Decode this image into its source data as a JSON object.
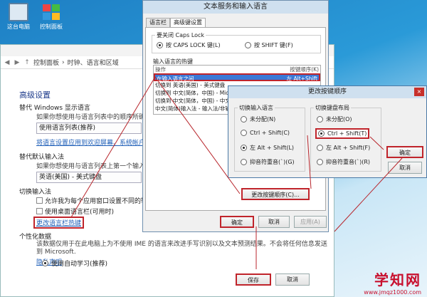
{
  "desktop": {
    "icons": [
      {
        "label": "这台电脑",
        "icon": "computer-icon"
      },
      {
        "label": "控制面板",
        "icon": "control-panel-icon"
      }
    ]
  },
  "control_panel": {
    "window_title": "控制面板\\时钟",
    "breadcrumb": [
      "控制面板",
      "时钟、语言和区域"
    ],
    "advanced_title": "高级设置",
    "display_lang_heading": "替代 Windows 显示语言",
    "display_lang_desc": "如果你想使用与语言列表中的顺序所确定的",
    "display_lang_value": "使用语言列表(推荐)",
    "apply_link": "将语言设置应用到欢迎屏幕、系统帐户和新用户",
    "input_method_heading": "替代默认输入法",
    "input_method_desc": "如果你想使用与语言列表上第一个输入法不同的",
    "input_method_value": "英语(美国) - 美式键盘",
    "switch_heading": "切换输入法",
    "cb_each_window": "允许我为每个应用窗口设置不同的输入法",
    "cb_desktop_bar": "使用桌面语言栏(可用时)",
    "hotkey_link": "更改语言栏热键",
    "personal_heading": "个性化数据",
    "personal_desc": "该数据仅用于在此电脑上为不使用 IME 的语言来改进手写识别以及文本预测结果。不会将任何信息发送到 Microsoft.",
    "privacy_link": "隐私声明",
    "auto_learn": "使用自动学习(推荐)",
    "save_label": "保存",
    "cancel_label": "取消"
  },
  "text_services": {
    "title": "文本服务和输入语言",
    "tabs": [
      "语言栏",
      "高级键设置"
    ],
    "caps_group": "要关闭 Caps Lock",
    "caps_opt1": "按 CAPS LOCK 键(L)",
    "caps_opt2": "按 SHIFT 键(F)",
    "hotkey_group": "输入语言的热键",
    "col_action": "操作",
    "col_keys": "按键顺序(K)",
    "rows": [
      {
        "action": "在输入语言之间",
        "keys": "左 Alt+Shift"
      },
      {
        "action": "切换到 英语(美国) - 美式键盘",
        "keys": ""
      },
      {
        "action": "切换到 中文(简体，中国) - Micr",
        "keys": ""
      },
      {
        "action": "切换到 中文(简体，中国) - 中文(",
        "keys": ""
      },
      {
        "action": "中文(简体)输入法 - 输入法/非输",
        "keys": ""
      }
    ],
    "change_seq_label": "更改按键顺序(C)...",
    "ok_label": "确定",
    "cancel_label": "取消",
    "apply_label": "应用(A)"
  },
  "change_keys": {
    "title": "更改按键顺序",
    "left_group": "切换输入语言",
    "left_options": [
      "未分配(N)",
      "Ctrl + Shift(C)",
      "左 Alt + Shift(L)",
      "抑音符重音(`)(G)"
    ],
    "left_selected": 2,
    "right_group": "切换键盘布局",
    "right_options": [
      "未分配(O)",
      "Ctrl + Shift(T)",
      "左 Alt + Shift(F)",
      "抑音符重音(`)(R)"
    ],
    "right_selected": 1,
    "ok_label": "确定",
    "cancel_label": "取消"
  },
  "watermark": {
    "main": "学知网",
    "url": "www.jmqz1000.com"
  }
}
